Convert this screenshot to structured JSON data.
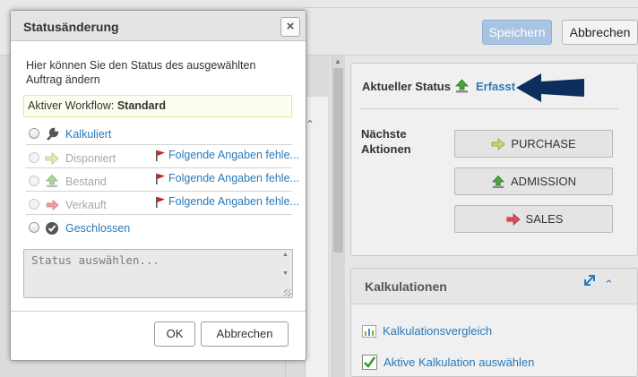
{
  "toolbar": {
    "save_label": "Speichern",
    "cancel_label": "Abbrechen"
  },
  "status_panel": {
    "current_label": "Aktueller Status",
    "current_value": "Erfasst",
    "next_label": "Nächste Aktionen",
    "actions": [
      "PURCHASE",
      "ADMISSION",
      "SALES"
    ]
  },
  "calc_panel": {
    "title": "Kalkulationen",
    "items": [
      "Kalkulationsvergleich",
      "Aktive Kalkulation auswählen"
    ]
  },
  "dialog": {
    "title": "Statusänderung",
    "close_symbol": "×",
    "description": "Hier können Sie den Status des ausgewählten Auftrag ändern",
    "workflow_label": "Aktiver Workflow:",
    "workflow_value": "Standard",
    "statuses": [
      {
        "label": "Kalkuliert",
        "enabled": true,
        "icon": "wrench-icon",
        "warning": ""
      },
      {
        "label": "Disponiert",
        "enabled": false,
        "icon": "arrow-right-icon",
        "warning": "Folgende Angaben fehle..."
      },
      {
        "label": "Bestand",
        "enabled": false,
        "icon": "upload-icon",
        "warning": "Folgende Angaben fehle..."
      },
      {
        "label": "Verkauft",
        "enabled": false,
        "icon": "arrow-out-icon",
        "warning": "Folgende Angaben fehle..."
      },
      {
        "label": "Geschlossen",
        "enabled": true,
        "icon": "check-circle-icon",
        "warning": ""
      }
    ],
    "textarea_placeholder": "Status auswählen...",
    "ok_label": "OK",
    "cancel_label": "Abbrechen"
  },
  "colors": {
    "accent": "#2a7ab8",
    "save_button": "#a9c4e3",
    "navy_arrow": "#0d2d5c",
    "flag": "#cc2222"
  }
}
